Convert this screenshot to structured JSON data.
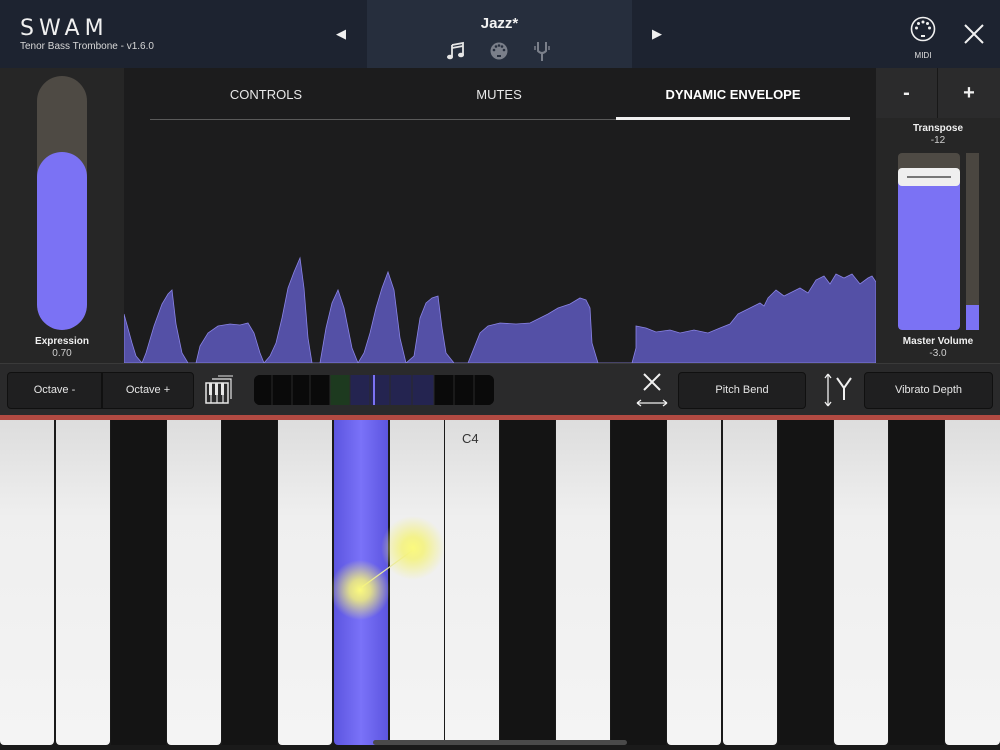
{
  "header": {
    "brand": "SWAM",
    "subtitle": "Tenor Bass Trombone - v1.6.0",
    "preset_name": "Jazz*",
    "prev_arrow": "◀",
    "next_arrow": "▶",
    "preset_icons": [
      "music-note-icon",
      "midi-plug-icon",
      "tuning-fork-icon"
    ],
    "midi_label": "MIDI"
  },
  "expression": {
    "label": "Expression",
    "value": "0.70",
    "level": 0.7
  },
  "tabs": [
    {
      "label": "CONTROLS",
      "active": false
    },
    {
      "label": "MUTES",
      "active": false
    },
    {
      "label": "DYNAMIC ENVELOPE",
      "active": true
    }
  ],
  "transpose": {
    "minus_label": "-",
    "plus_label": "+",
    "label": "Transpose",
    "value": "-12"
  },
  "master_volume": {
    "label": "Master Volume",
    "value": "-3.0",
    "level": 0.84,
    "meter_level": 0.14
  },
  "toolbar": {
    "octave_minus": "Octave -",
    "octave_plus": "Octave +",
    "x_axis_label": "X",
    "y_axis_label": "Y",
    "pitch_bend": "Pitch Bend",
    "vibrato_depth": "Vibrato Depth"
  },
  "keyboard": {
    "c4_label": "C4",
    "active_key_color": "#6a62f0",
    "touch_color": "#f6f27a"
  },
  "colors": {
    "accent": "#7b72f4",
    "envelope_fill": "#5450a6",
    "header_bg": "#1d2330",
    "red_line": "#b24a42"
  }
}
